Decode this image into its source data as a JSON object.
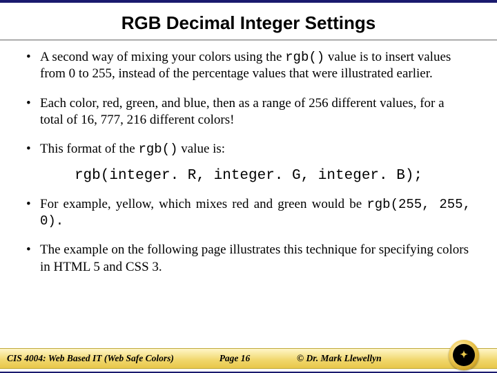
{
  "title": "RGB Decimal Integer Settings",
  "bullets": {
    "b1a": "A second way of mixing your colors using the ",
    "b1code": "rgb()",
    "b1b": " value is to insert values from 0 to 255, instead of the percentage values that were illustrated earlier.",
    "b2": "Each color, red, green, and blue, then as a range of 256 different values, for a total of 16, 777, 216 different colors!",
    "b3a": "This format of the ",
    "b3code": "rgb()",
    "b3b": " value is:",
    "syntax": "rgb(integer. R, integer. G, integer. B);",
    "b4a": "For example, yellow, which mixes red and green would be ",
    "b4code": "rgb(255, 255, 0).",
    "b5": "The example on the following page illustrates this technique for specifying colors in HTML 5 and CSS 3."
  },
  "footer": {
    "course": "CIS 4004: Web Based IT (Web Safe Colors)",
    "page": "Page 16",
    "author": "© Dr. Mark Llewellyn"
  }
}
